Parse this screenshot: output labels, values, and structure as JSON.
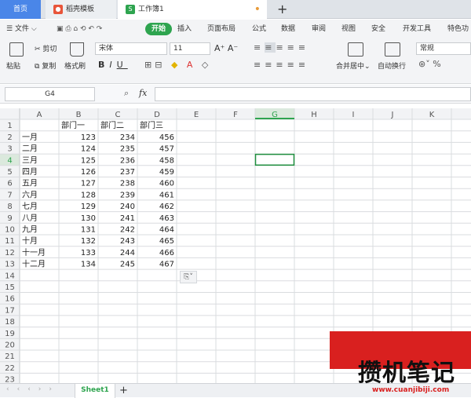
{
  "tabs": {
    "home": "首页",
    "template": "稻壳模板",
    "workbook": "工作簿1",
    "add": "+"
  },
  "menu": {
    "file": "文件",
    "start": "开始",
    "items": [
      "插入",
      "页面布局",
      "公式",
      "数据",
      "审阅",
      "视图",
      "安全",
      "开发工具",
      "特色功"
    ]
  },
  "toolbar": {
    "paste": "粘贴",
    "cut": "剪切",
    "copy": "复制",
    "format_painter": "格式刷",
    "font_name": "宋体",
    "font_size": "11",
    "merge_center": "合并居中",
    "wrap_text": "自动换行",
    "number_format": "常规"
  },
  "formula_bar": {
    "name_box": "G4",
    "fx": "fx"
  },
  "grid": {
    "columns": [
      "A",
      "B",
      "C",
      "D",
      "E",
      "F",
      "G",
      "H",
      "I",
      "J",
      "K"
    ],
    "row_count": 23,
    "selected_cell": "G4",
    "cells": [
      [
        "",
        "部门一",
        "部门二",
        "部门三"
      ],
      [
        "一月",
        "123",
        "234",
        "456"
      ],
      [
        "二月",
        "124",
        "235",
        "457"
      ],
      [
        "三月",
        "125",
        "236",
        "458"
      ],
      [
        "四月",
        "126",
        "237",
        "459"
      ],
      [
        "五月",
        "127",
        "238",
        "460"
      ],
      [
        "六月",
        "128",
        "239",
        "461"
      ],
      [
        "七月",
        "129",
        "240",
        "462"
      ],
      [
        "八月",
        "130",
        "241",
        "463"
      ],
      [
        "九月",
        "131",
        "242",
        "464"
      ],
      [
        "十月",
        "132",
        "243",
        "465"
      ],
      [
        "十一月",
        "133",
        "244",
        "466"
      ],
      [
        "十二月",
        "134",
        "245",
        "467"
      ]
    ]
  },
  "sheet": {
    "name": "Sheet1",
    "add": "+"
  },
  "watermark": {
    "text": "攒机笔记",
    "url": "www.cuanjibiji.com"
  },
  "colors": {
    "accent": "#2ea44f",
    "tab_blue": "#4a86e8",
    "selection": "#1e8e3e"
  }
}
